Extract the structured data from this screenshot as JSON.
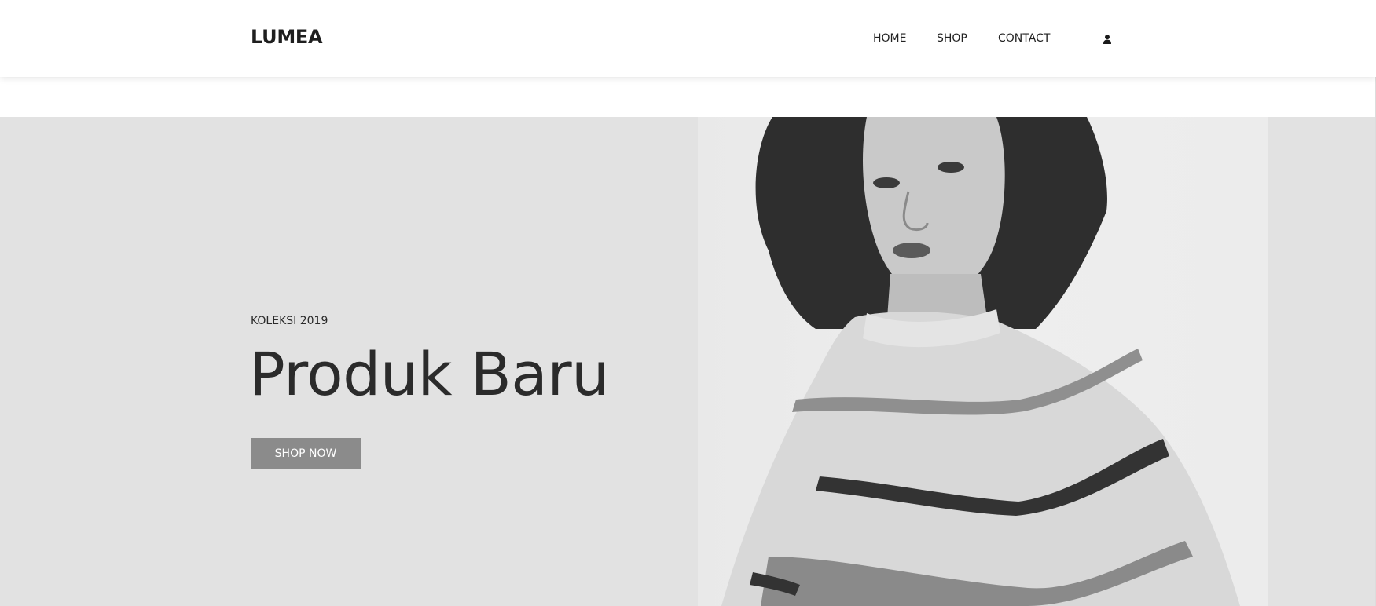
{
  "header": {
    "logo": "LUMEA",
    "nav": [
      {
        "label": "HOME"
      },
      {
        "label": "SHOP"
      },
      {
        "label": "CONTACT"
      }
    ],
    "account_icon": "user-icon"
  },
  "hero": {
    "eyebrow": "KOLEKSI 2019",
    "title": "Produk Baru",
    "cta_label": "SHOP NOW",
    "image": "model-in-striped-sweater-photo"
  },
  "colors": {
    "hero_background": "#e2e2e2",
    "cta_background": "#8b8b8b",
    "text_dark": "#2b2b2b"
  }
}
